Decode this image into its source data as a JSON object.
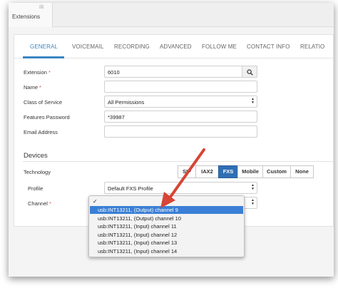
{
  "window": {
    "tab_label": "Extensions",
    "tab_close": "☒"
  },
  "tabs": [
    {
      "label": "GENERAL"
    },
    {
      "label": "VOICEMAIL"
    },
    {
      "label": "RECORDING"
    },
    {
      "label": "ADVANCED"
    },
    {
      "label": "FOLLOW ME"
    },
    {
      "label": "CONTACT INFO"
    },
    {
      "label": "RELATIO"
    }
  ],
  "form": {
    "extension": {
      "label": "Extension",
      "required": "*",
      "value": "6010"
    },
    "name": {
      "label": "Name",
      "required": "*",
      "value": ""
    },
    "class_of_service": {
      "label": "Class of Service",
      "value": "All Permissions"
    },
    "features_password": {
      "label": "Features Password",
      "value": "*39987"
    },
    "email_address": {
      "label": "Email Address",
      "value": ""
    }
  },
  "devices": {
    "title": "Devices",
    "technology": {
      "label": "Technology",
      "options": [
        {
          "label": "SIP"
        },
        {
          "label": "IAX2"
        },
        {
          "label": "FXS"
        },
        {
          "label": "Mobile"
        },
        {
          "label": "Custom"
        },
        {
          "label": "None"
        }
      ],
      "selected": "FXS"
    },
    "profile": {
      "label": "Profile",
      "value": "Default FXS Profile"
    },
    "channel": {
      "label": "Channel",
      "required": "*",
      "check": "✓",
      "options": [
        {
          "label": "usb:INT13211, (Output) channel 9"
        },
        {
          "label": "usb:INT13211, (Output) channel 10"
        },
        {
          "label": "usb:INT13211, (Input) channel 11"
        },
        {
          "label": "usb:INT13211, (Input) channel 12"
        },
        {
          "label": "usb:INT13211, (Input) channel 13"
        },
        {
          "label": "usb:INT13211, (Input) channel 14"
        }
      ],
      "highlighted": "usb:INT13211, (Output) channel 9"
    }
  },
  "colors": {
    "accent": "#3b86c3",
    "active_button": "#2f6fb3",
    "highlight": "#3a7fd5",
    "required": "#d9534f",
    "annotation_arrow": "#d64535"
  },
  "icons": {
    "search": "search-icon",
    "select": "chevron-up-down-icon"
  }
}
